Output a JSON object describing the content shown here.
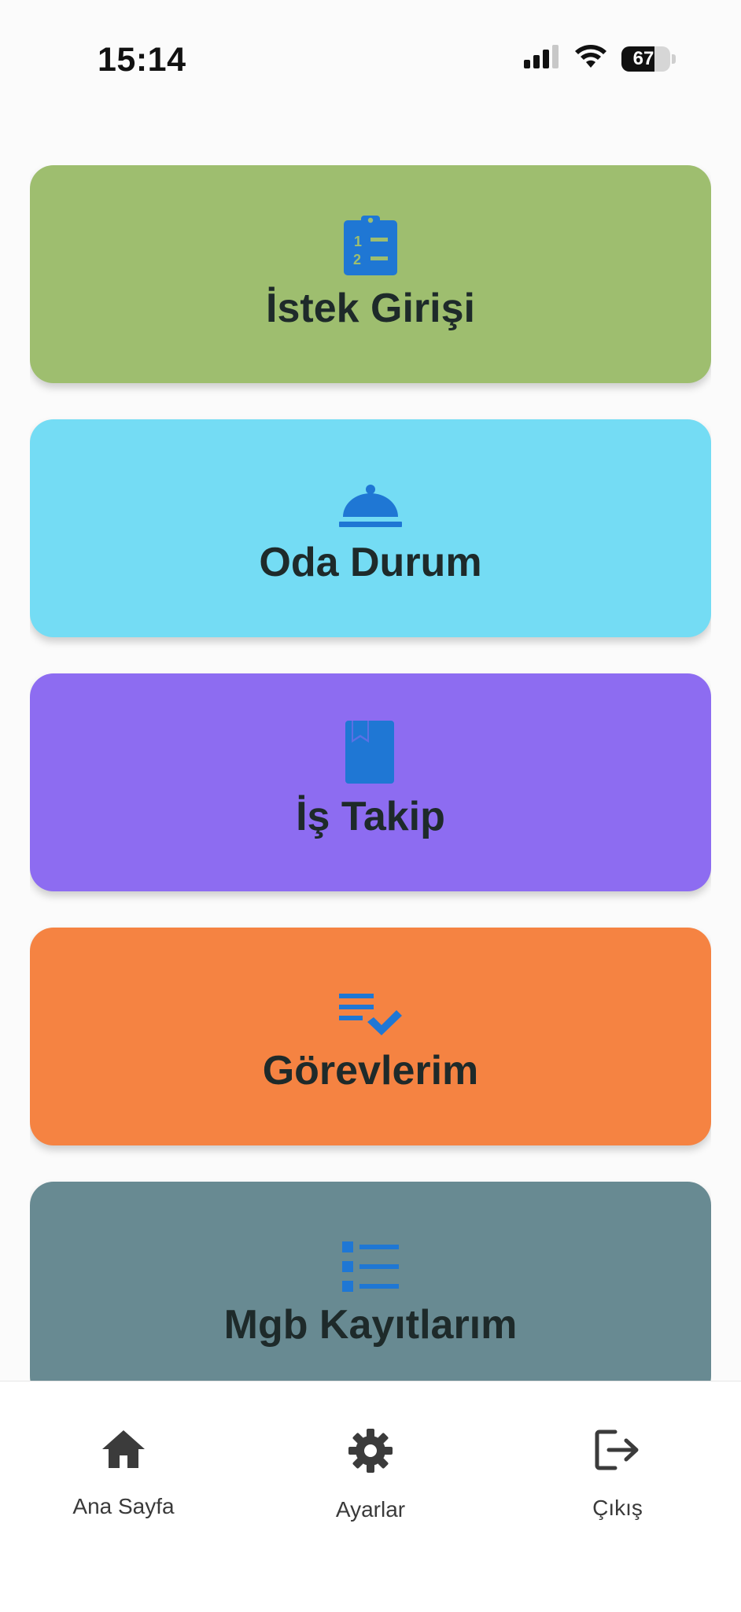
{
  "status_bar": {
    "time": "15:14",
    "battery": "67"
  },
  "menu": {
    "items": [
      {
        "label": "İstek Girişi",
        "icon": "clipboard-list-icon",
        "color": "#9ebe6f"
      },
      {
        "label": "Oda Durum",
        "icon": "room-service-icon",
        "color": "#74dcf4"
      },
      {
        "label": "İş Takip",
        "icon": "book-bookmark-icon",
        "color": "#8d6cf1"
      },
      {
        "label": "Görevlerim",
        "icon": "playlist-check-icon",
        "color": "#f58342"
      },
      {
        "label": "Mgb Kayıtlarım",
        "icon": "list-icon",
        "color": "#688a92"
      }
    ],
    "icon_color": "#1f77d4"
  },
  "bottom_nav": {
    "home": "Ana Sayfa",
    "settings": "Ayarlar",
    "logout": "Çıkış"
  }
}
